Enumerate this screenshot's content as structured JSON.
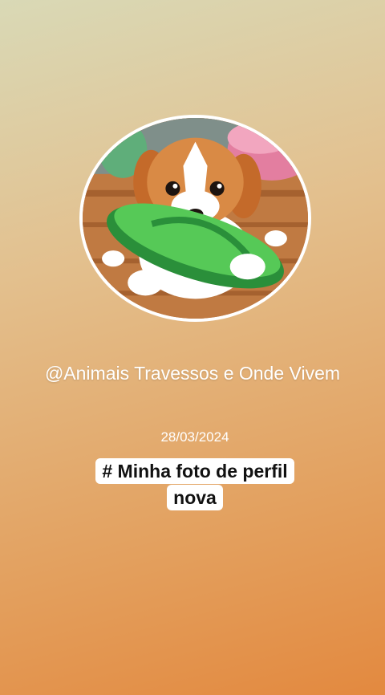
{
  "profile": {
    "avatar_alt": "puppy-with-flip-flop",
    "username": "@Animais Travessos e Onde Vivem",
    "date": "28/03/2024",
    "caption": "# Minha foto de perfil nova"
  },
  "colors": {
    "gradient_top": "#d9d9b6",
    "gradient_bottom": "#e3893f",
    "avatar_border": "#ffffff",
    "caption_bg": "#ffffff"
  }
}
